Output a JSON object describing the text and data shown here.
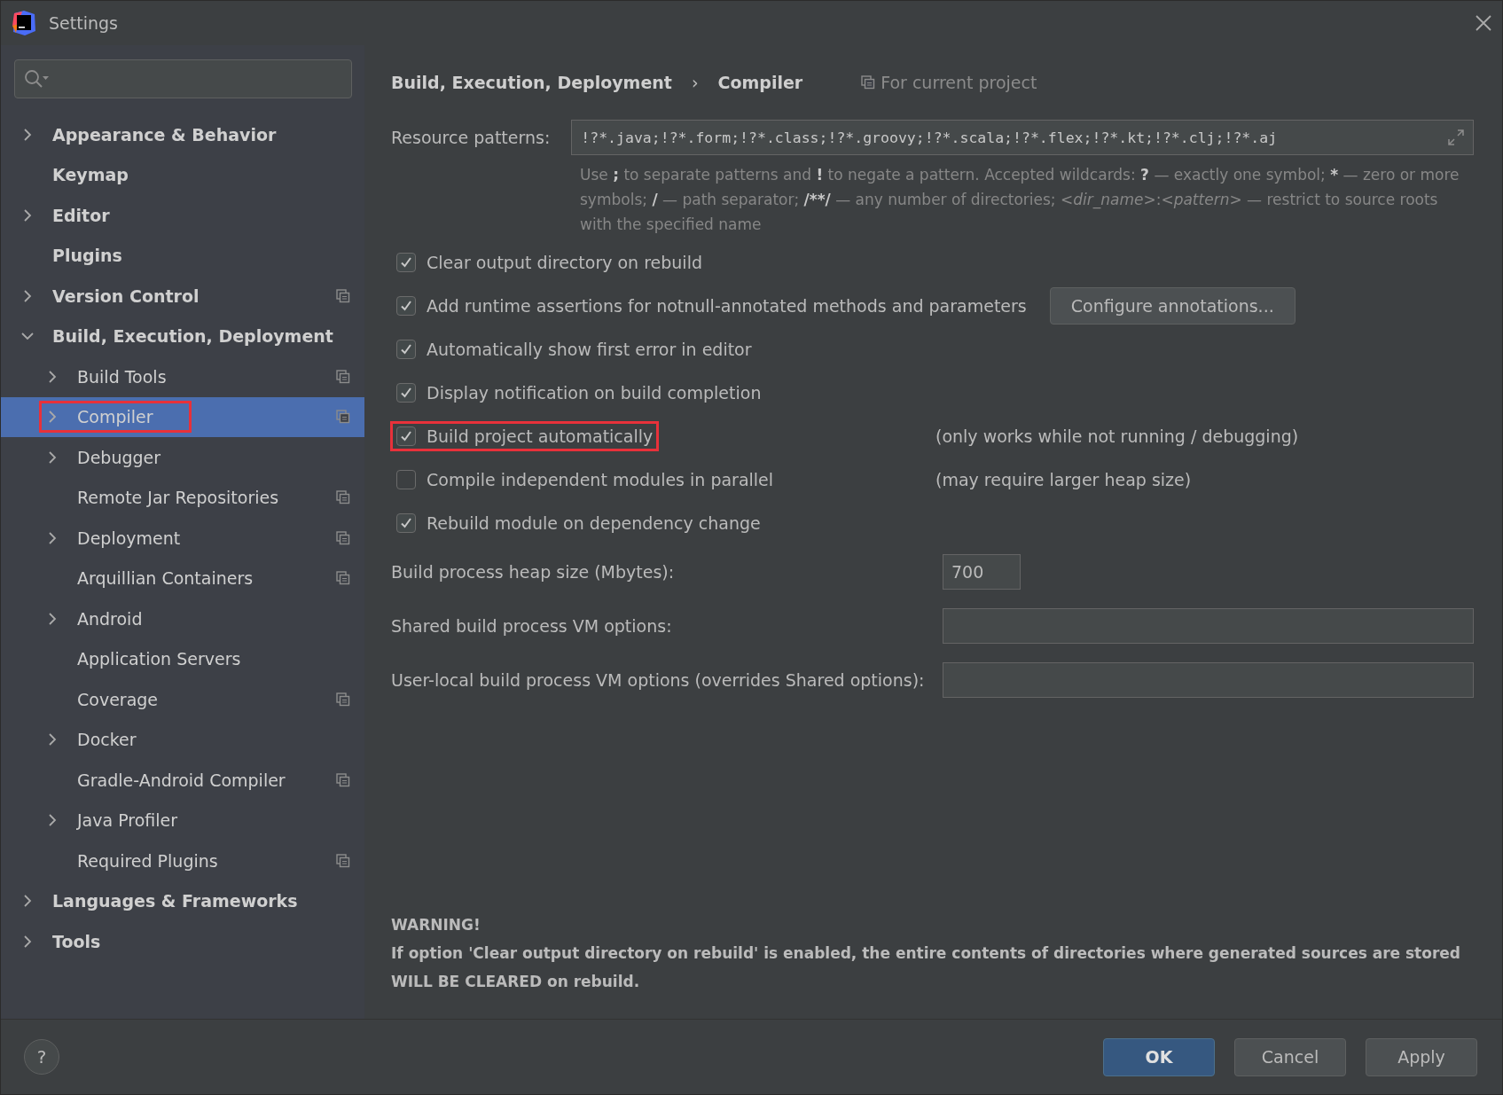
{
  "window": {
    "title": "Settings"
  },
  "sidebar": {
    "items": [
      {
        "label": "Appearance & Behavior",
        "expanded": false,
        "selected": false,
        "highlighted": false,
        "project_scope": false
      },
      {
        "label": "Keymap",
        "selected": false,
        "highlighted": false,
        "project_scope": false
      },
      {
        "label": "Editor",
        "expanded": false,
        "selected": false,
        "highlighted": false,
        "project_scope": false
      },
      {
        "label": "Plugins",
        "selected": false,
        "highlighted": false,
        "project_scope": false
      },
      {
        "label": "Version Control",
        "expanded": false,
        "selected": false,
        "highlighted": false,
        "project_scope": true
      },
      {
        "label": "Build, Execution, Deployment",
        "expanded": true,
        "selected": false,
        "highlighted": false,
        "project_scope": false,
        "children": [
          {
            "label": "Build Tools",
            "expanded": false,
            "selected": false,
            "highlighted": false,
            "project_scope": true
          },
          {
            "label": "Compiler",
            "expanded": false,
            "selected": true,
            "highlighted": true,
            "project_scope": true
          },
          {
            "label": "Debugger",
            "expanded": false,
            "selected": false,
            "highlighted": false,
            "project_scope": false
          },
          {
            "label": "Remote Jar Repositories",
            "selected": false,
            "highlighted": false,
            "project_scope": true
          },
          {
            "label": "Deployment",
            "expanded": false,
            "selected": false,
            "highlighted": false,
            "project_scope": true
          },
          {
            "label": "Arquillian Containers",
            "selected": false,
            "highlighted": false,
            "project_scope": true
          },
          {
            "label": "Android",
            "expanded": false,
            "selected": false,
            "highlighted": false,
            "project_scope": false
          },
          {
            "label": "Application Servers",
            "selected": false,
            "highlighted": false,
            "project_scope": false
          },
          {
            "label": "Coverage",
            "selected": false,
            "highlighted": false,
            "project_scope": true
          },
          {
            "label": "Docker",
            "expanded": false,
            "selected": false,
            "highlighted": false,
            "project_scope": false
          },
          {
            "label": "Gradle-Android Compiler",
            "selected": false,
            "highlighted": false,
            "project_scope": true
          },
          {
            "label": "Java Profiler",
            "expanded": false,
            "selected": false,
            "highlighted": false,
            "project_scope": false
          },
          {
            "label": "Required Plugins",
            "selected": false,
            "highlighted": false,
            "project_scope": true
          }
        ]
      },
      {
        "label": "Languages & Frameworks",
        "expanded": false,
        "selected": false,
        "highlighted": false,
        "project_scope": false
      },
      {
        "label": "Tools",
        "expanded": false,
        "selected": false,
        "highlighted": false,
        "project_scope": false
      }
    ]
  },
  "breadcrumb": {
    "parent": "Build, Execution, Deployment",
    "separator": "›",
    "current": "Compiler",
    "scope": "For current project"
  },
  "resource_patterns": {
    "label": "Resource patterns:",
    "value": "!?*.java;!?*.form;!?*.class;!?*.groovy;!?*.scala;!?*.flex;!?*.kt;!?*.clj;!?*.aj",
    "hint": [
      {
        "kind": "plain",
        "text": "Use "
      },
      {
        "kind": "bold",
        "text": ";"
      },
      {
        "kind": "plain",
        "text": " to separate patterns and "
      },
      {
        "kind": "bold",
        "text": "!"
      },
      {
        "kind": "plain",
        "text": " to negate a pattern. Accepted wildcards: "
      },
      {
        "kind": "bold",
        "text": "?"
      },
      {
        "kind": "plain",
        "text": " — exactly one symbol; "
      },
      {
        "kind": "bold",
        "text": "*"
      },
      {
        "kind": "plain",
        "text": " — zero or more symbols; "
      },
      {
        "kind": "bold",
        "text": "/"
      },
      {
        "kind": "plain",
        "text": " — path separator; "
      },
      {
        "kind": "bold",
        "text": "/**/"
      },
      {
        "kind": "plain",
        "text": " — any number of directories; "
      },
      {
        "kind": "italic",
        "text": "<dir_name>"
      },
      {
        "kind": "plain",
        "text": ":"
      },
      {
        "kind": "italic",
        "text": "<pattern>"
      },
      {
        "kind": "plain",
        "text": " — restrict to source roots with the specified name"
      }
    ]
  },
  "options": [
    {
      "label": "Clear output directory on rebuild",
      "checked": true,
      "highlighted": false
    },
    {
      "label": "Add runtime assertions for notnull-annotated methods and parameters",
      "checked": true,
      "highlighted": false,
      "button": "Configure annotations..."
    },
    {
      "label": "Automatically show first error in editor",
      "checked": true,
      "highlighted": false
    },
    {
      "label": "Display notification on build completion",
      "checked": true,
      "highlighted": false
    },
    {
      "label": "Build project automatically",
      "checked": true,
      "highlighted": true,
      "note": "(only works while not running / debugging)"
    },
    {
      "label": "Compile independent modules in parallel",
      "checked": false,
      "highlighted": false,
      "note": "(may require larger heap size)"
    },
    {
      "label": "Rebuild module on dependency change",
      "checked": true,
      "highlighted": false
    }
  ],
  "fields": [
    {
      "label": "Build process heap size (Mbytes):",
      "value": "700",
      "kind": "short"
    },
    {
      "label": "Shared build process VM options:",
      "kind": "wide"
    },
    {
      "label": "User-local build process VM options (overrides Shared options):",
      "kind": "wide"
    }
  ],
  "warning": {
    "title": "WARNING!",
    "lines": [
      "If option 'Clear output directory on rebuild' is enabled, the entire contents of directories where generated sources are stored",
      "WILL BE CLEARED on rebuild."
    ]
  },
  "footer": {
    "help": "?",
    "buttons": [
      {
        "label": "OK",
        "kind": "primary"
      },
      {
        "label": "Cancel",
        "kind": "default"
      },
      {
        "label": "Apply",
        "kind": "default"
      }
    ]
  }
}
